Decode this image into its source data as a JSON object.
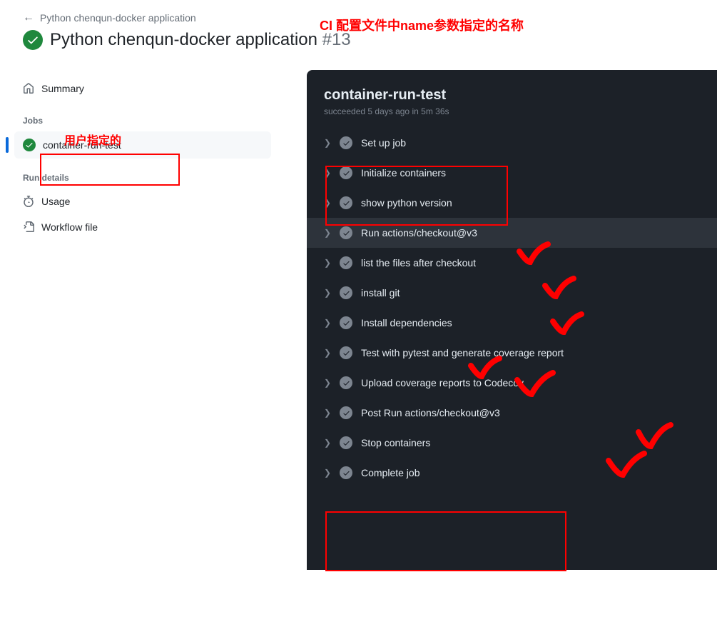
{
  "breadcrumb": {
    "workflow_name": "Python chenqun-docker application"
  },
  "workflow": {
    "title": "Python chenqun-docker application",
    "run_number": "#13"
  },
  "sidebar": {
    "summary_label": "Summary",
    "jobs_heading": "Jobs",
    "job_name": "container-run-test",
    "run_details_heading": "Run details",
    "usage_label": "Usage",
    "workflow_file_label": "Workflow file"
  },
  "job": {
    "title": "container-run-test",
    "status_prefix": "succeeded",
    "when": "5 days ago",
    "duration_prefix": "in",
    "duration": "5m 36s"
  },
  "steps": [
    {
      "label": "Set up job",
      "highlighted": false
    },
    {
      "label": "Initialize containers",
      "highlighted": false
    },
    {
      "label": "show python version",
      "highlighted": false
    },
    {
      "label": "Run actions/checkout@v3",
      "highlighted": true
    },
    {
      "label": "list the files after checkout",
      "highlighted": false
    },
    {
      "label": "install git",
      "highlighted": false
    },
    {
      "label": "Install dependencies",
      "highlighted": false
    },
    {
      "label": "Test with pytest and generate coverage report",
      "highlighted": false
    },
    {
      "label": "Upload coverage reports to Codecov",
      "highlighted": false
    },
    {
      "label": "Post Run actions/checkout@v3",
      "highlighted": false
    },
    {
      "label": "Stop containers",
      "highlighted": false
    },
    {
      "label": "Complete job",
      "highlighted": false
    }
  ],
  "annotations": {
    "top_text": "CI 配置文件中name参数指定的名称",
    "sidebar_text": "用户指定的"
  }
}
